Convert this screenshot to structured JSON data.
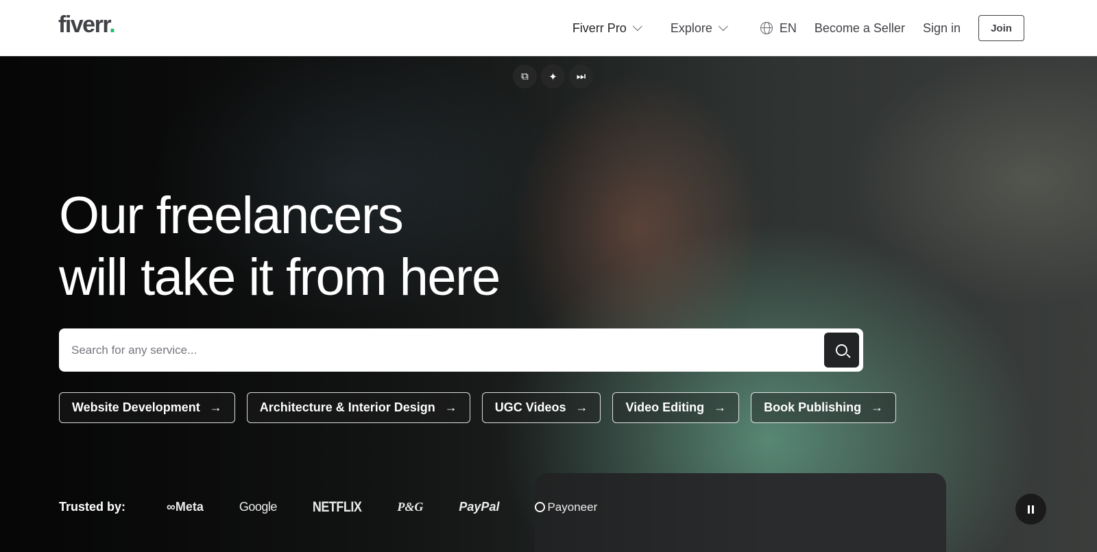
{
  "header": {
    "logo_text": "fiverr",
    "logo_dot": ".",
    "nav": {
      "fiverr_pro": "Fiverr Pro",
      "explore": "Explore",
      "language": "EN",
      "become_seller": "Become a Seller",
      "sign_in": "Sign in",
      "join": "Join"
    }
  },
  "hero": {
    "headline_line1": "Our freelancers",
    "headline_line2": "will take it from here",
    "search": {
      "placeholder": "Search for any service..."
    },
    "categories": [
      {
        "label": "Website Development",
        "arrow": "→"
      },
      {
        "label": "Architecture & Interior Design",
        "arrow": "→"
      },
      {
        "label": "UGC Videos",
        "arrow": "→"
      },
      {
        "label": "Video Editing",
        "arrow": "→"
      },
      {
        "label": "Book Publishing",
        "arrow": "→"
      }
    ],
    "trusted_label": "Trusted by:",
    "brands": {
      "meta": "∞Meta",
      "google": "Google",
      "netflix": "NETFLIX",
      "pg": "P&G",
      "paypal": "PayPal",
      "payoneer": "Payoneer"
    }
  },
  "icons": {
    "video_controls": [
      "picture-in-picture-icon",
      "sparkle-icon",
      "skip-forward-icon"
    ],
    "search": "search-icon",
    "pause": "pause-icon"
  },
  "colors": {
    "brand_green": "#1dbf73",
    "text_dark": "#404145",
    "search_button": "#222325"
  }
}
